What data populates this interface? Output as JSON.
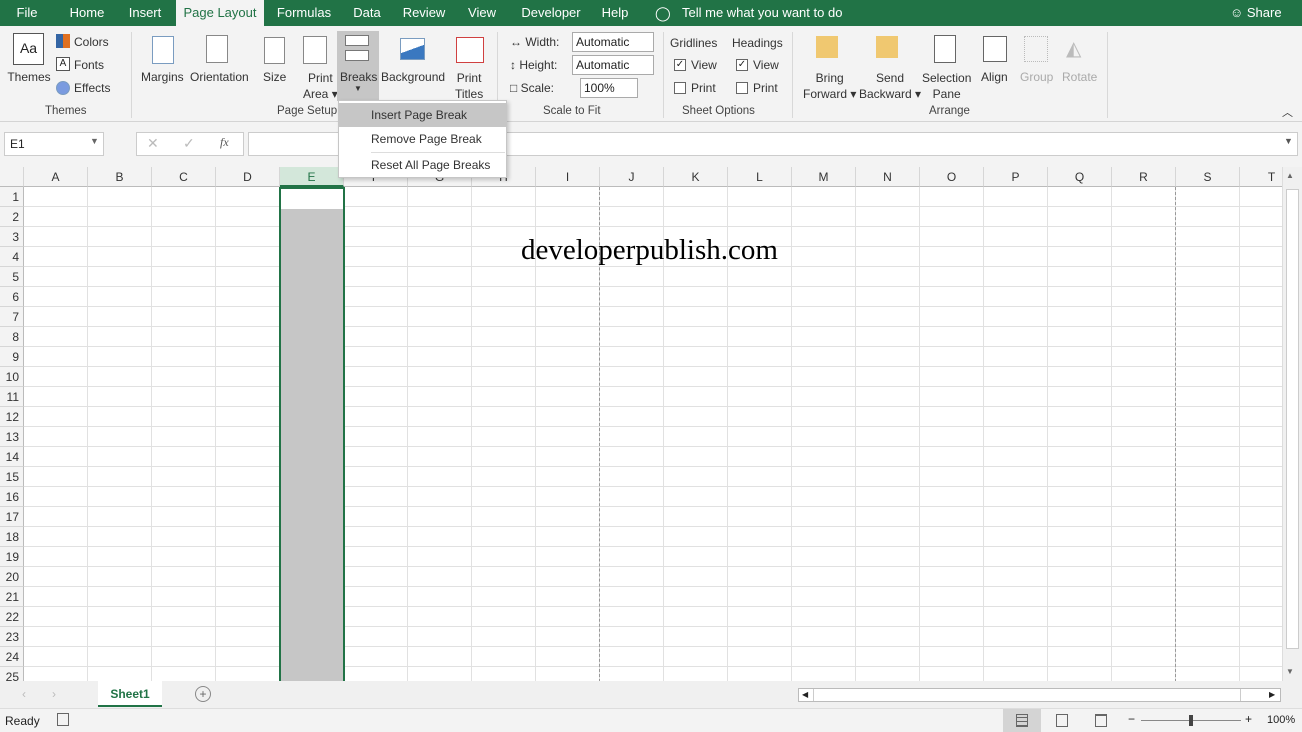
{
  "tabs": [
    "File",
    "Home",
    "Insert",
    "Page Layout",
    "Formulas",
    "Data",
    "Review",
    "View",
    "Developer",
    "Help"
  ],
  "active_tab": "Page Layout",
  "tell_me": "Tell me what you want to do",
  "share": "Share",
  "ribbon": {
    "themes": {
      "themes": "Themes",
      "colors": "Colors",
      "fonts": "Fonts",
      "effects": "Effects",
      "group": "Themes"
    },
    "page_setup": {
      "margins": "Margins",
      "orientation": "Orientation",
      "size": "Size",
      "print_area_1": "Print",
      "print_area_2": "Area",
      "breaks": "Breaks",
      "background": "Background",
      "print_titles_1": "Print",
      "print_titles_2": "Titles",
      "group": "Page Setup"
    },
    "scale": {
      "width_label": "Width:",
      "width_value": "Automatic",
      "height_label": "Height:",
      "height_value": "Automatic",
      "scale_label": "Scale:",
      "scale_value": "100%",
      "group": "Scale to Fit"
    },
    "sheet_options": {
      "gridlines": "Gridlines",
      "headings": "Headings",
      "view": "View",
      "print": "Print",
      "gridlines_view": true,
      "gridlines_print": false,
      "headings_view": true,
      "headings_print": false,
      "group": "Sheet Options"
    },
    "arrange": {
      "bring_1": "Bring",
      "bring_2": "Forward",
      "send_1": "Send",
      "send_2": "Backward",
      "sel_1": "Selection",
      "sel_2": "Pane",
      "align": "Align",
      "group_btn": "Group",
      "rotate": "Rotate",
      "group": "Arrange"
    }
  },
  "breaks_menu": [
    "Insert Page Break",
    "Remove Page Break",
    "Reset All Page Breaks"
  ],
  "name_box": "E1",
  "fx": "fx",
  "columns": [
    "A",
    "B",
    "C",
    "D",
    "E",
    "F",
    "G",
    "H",
    "I",
    "J",
    "K",
    "L",
    "M",
    "N",
    "O",
    "P",
    "Q",
    "R",
    "S",
    "T"
  ],
  "rows": [
    "1",
    "2",
    "3",
    "4",
    "5",
    "6",
    "7",
    "8",
    "9",
    "10",
    "11",
    "12",
    "13",
    "14",
    "15",
    "16",
    "17",
    "18",
    "19",
    "20",
    "21",
    "22",
    "23",
    "24",
    "25"
  ],
  "selected_column": "E",
  "cell_text": "developerpublish.com",
  "sheet_tab": "Sheet1",
  "status": "Ready",
  "zoom": "100%",
  "colors": {
    "accent": "#217346",
    "selection": "#c6c6c6"
  }
}
